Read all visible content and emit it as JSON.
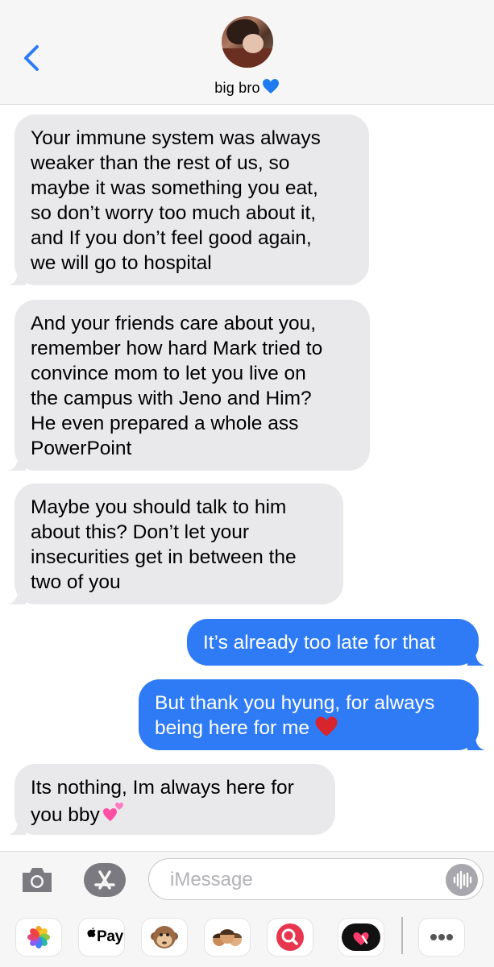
{
  "header": {
    "contact_name": "big bro",
    "colors": {
      "back": "#2f7bf6",
      "background": "#f6f6f6"
    }
  },
  "messages": [
    {
      "from": "contact",
      "text": "Your immune system was always weaker than the rest of us, so maybe it was something you eat, so don’t worry too much about it, and If you don’t feel good again, we will go to hospital"
    },
    {
      "from": "contact",
      "text": "And your friends care about you, remember how hard Mark tried to convince mom to let you live on the campus with Jeno and Him? He even prepared a whole ass PowerPoint"
    },
    {
      "from": "contact",
      "text": "Maybe you should talk to him about this? Don’t let your insecurities get in between the two of you"
    },
    {
      "from": "me",
      "text": "It’s already too late for that"
    },
    {
      "from": "me",
      "text": "But thank you hyung, for always being here for me"
    },
    {
      "from": "contact",
      "text": "Its nothing, Im always here for you bby"
    }
  ],
  "bubble_lines": {
    "m0": [
      "Your immune system was always",
      "weaker than the rest of us, so",
      "maybe it was something you eat,",
      "so don’t worry too much about it,",
      "and If you don’t feel good again,",
      "we will go to hospital"
    ],
    "m1": [
      "And your friends care about you,",
      "remember how hard Mark tried to",
      "convince mom to let you live on",
      "the campus with Jeno and Him?",
      "He even prepared a whole ass",
      "PowerPoint"
    ],
    "m2": [
      "Maybe you should talk to him",
      "about this? Don’t let your",
      "insecurities get in between the",
      "two of you"
    ],
    "m3": [
      "It’s already too late for that"
    ],
    "m4": [
      "But thank you hyung, for always",
      "being here for me"
    ],
    "m5": [
      "Its nothing, Im always here for",
      "you bby"
    ]
  },
  "composer": {
    "placeholder": "iMessage"
  },
  "app_drawer": {
    "apple_pay_label": "Pay",
    "items": [
      "photos-icon",
      "apple-pay-icon",
      "monkey-memoji-icon",
      "memoji-stickers-icon",
      "image-search-icon",
      "digital-touch-icon",
      "more-icon"
    ]
  },
  "colors": {
    "sent_bubble": "#2f7bf6",
    "received_bubble": "#e9e9eb",
    "blue_heart": "#1e7bf0",
    "red_heart": "#d8242c",
    "pink_hearts": "#ff4fa3"
  }
}
